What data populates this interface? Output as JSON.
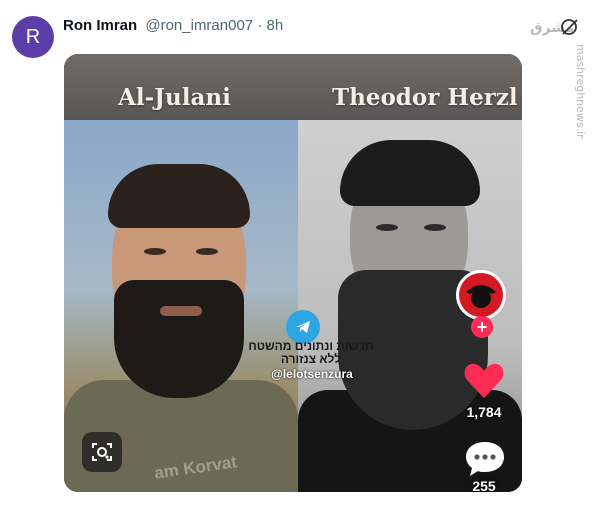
{
  "post": {
    "avatar_letter": "R",
    "display_name": "Ron Imran",
    "handle": "@ron_imran007",
    "separator": "·",
    "time": "8h"
  },
  "watermark": {
    "site_logo": "مشرق",
    "site_url": "mashreghnews.ir"
  },
  "media": {
    "label_left": "Al-Julani",
    "label_right": "Theodor Herzl",
    "overlay_hebrew": "חדשות ונתונים מהשטח ללא צנזורה",
    "overlay_handle": "@lelotsenzura",
    "faded_watermark": "am Korvat",
    "likes": "1,784",
    "comments": "255",
    "icons": [
      "telegram-icon",
      "heart-icon",
      "comment-bubble-icon",
      "scan-lens-icon",
      "grok-icon"
    ]
  },
  "colors": {
    "avatar_bg": "#5b3ea8",
    "tiktok_red": "#fe2c55",
    "telegram_blue": "#2ea6e3"
  }
}
